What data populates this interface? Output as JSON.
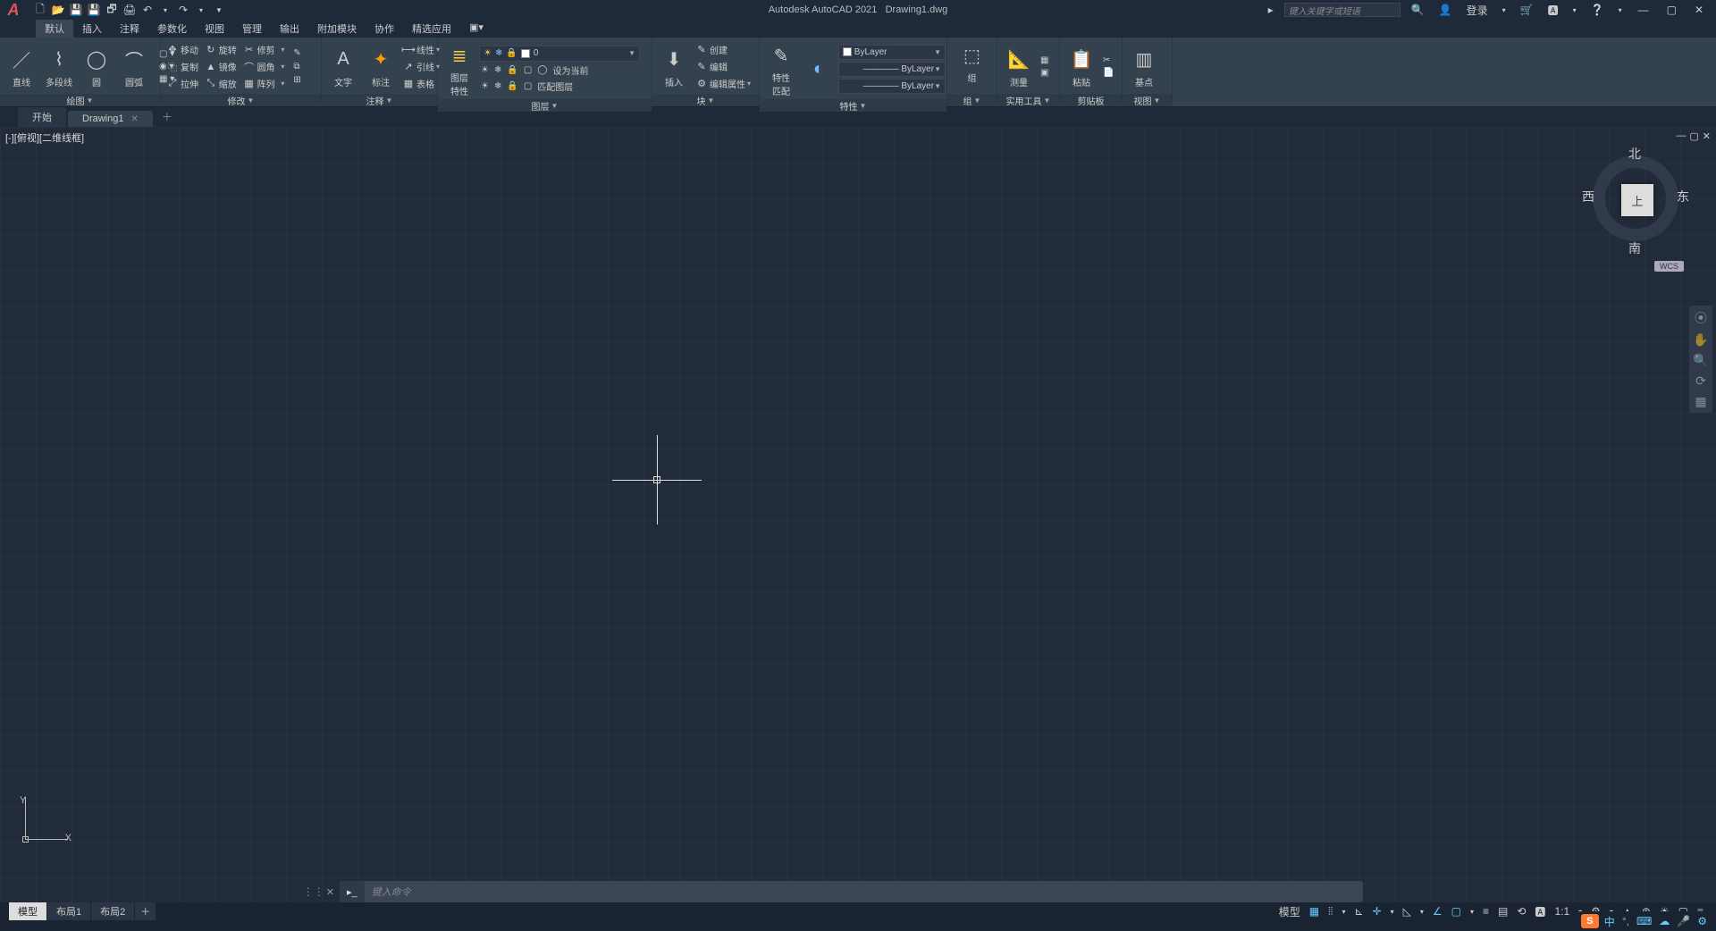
{
  "title": {
    "app": "Autodesk AutoCAD 2021",
    "file": "Drawing1.dwg"
  },
  "search": {
    "placeholder": "键入关键字或短语"
  },
  "login_label": "登录",
  "menu": [
    "默认",
    "插入",
    "注释",
    "参数化",
    "视图",
    "管理",
    "输出",
    "附加模块",
    "协作",
    "精选应用"
  ],
  "menu_active_index": 0,
  "ribbon": {
    "draw": {
      "title": "绘图",
      "arrow": "▼",
      "items": [
        "直线",
        "多段线",
        "圆",
        "圆弧"
      ]
    },
    "modify": {
      "title": "修改",
      "arrow": "▼",
      "rows": [
        [
          "✥",
          "移动",
          "↻",
          "旋转",
          "✂",
          "修剪",
          "▾"
        ],
        [
          "⿻",
          "复制",
          "▲",
          "镜像",
          "⌒",
          "圆角",
          "▾"
        ],
        [
          "⤢",
          "拉伸",
          "⤡",
          "缩放",
          "▦",
          "阵列",
          "▾"
        ]
      ],
      "extra": [
        "✎",
        "／",
        "⧉",
        "⊞",
        "∈"
      ]
    },
    "annotate": {
      "title": "注释",
      "arrow": "▼",
      "text": "文字",
      "dim": "标注",
      "leader": "引线",
      "rows": [
        [
          "⟼",
          "线性",
          "▾"
        ],
        [
          "↗",
          "引线",
          "▾"
        ],
        [
          "▦",
          "表格"
        ]
      ]
    },
    "layers": {
      "title": "图层",
      "arrow": "▼",
      "btn": "图层\n特性",
      "combo_value": "0",
      "icon_rows": [
        [
          "☀",
          "❄",
          "🔒",
          "▢",
          "◯"
        ],
        [
          "☀",
          "❄",
          "🔒",
          "▢",
          "◯",
          "设为当前"
        ],
        [
          "☀",
          "❄",
          "🔒",
          "▢",
          "匹配图层"
        ]
      ]
    },
    "block": {
      "title": "块",
      "arrow": "▼",
      "insert": "插入",
      "rows": [
        [
          "✎",
          "创建"
        ],
        [
          "✎",
          "编辑"
        ],
        [
          "⚙",
          "编辑属性",
          "▾"
        ]
      ]
    },
    "props": {
      "title": "特性",
      "arrow": "▼",
      "match": "特性\n匹配",
      "bylayer": "ByLayer"
    },
    "group": {
      "title": "组",
      "arrow": "▼",
      "btn": "组"
    },
    "util": {
      "title": "实用工具",
      "arrow": "▼",
      "meas": "测量",
      "calc": "▦"
    },
    "clip": {
      "title": "剪贴板",
      "paste": "粘贴"
    },
    "view": {
      "title": "视图",
      "arrow": "▼",
      "base": "基点"
    }
  },
  "doc_tabs": {
    "start": "开始",
    "drawing": "Drawing1"
  },
  "viewport": {
    "label": "[-][俯视][二维线框]"
  },
  "viewcube": {
    "n": "北",
    "s": "南",
    "e": "东",
    "w": "西",
    "top": "上",
    "wcs": "WCS"
  },
  "cmd": {
    "prefix": "▸_",
    "placeholder": "键入命令"
  },
  "bottom_tabs": [
    "模型",
    "布局1",
    "布局2"
  ],
  "status": {
    "model": "模型"
  },
  "tray": {
    "chn": "中",
    "sogou": "S"
  }
}
